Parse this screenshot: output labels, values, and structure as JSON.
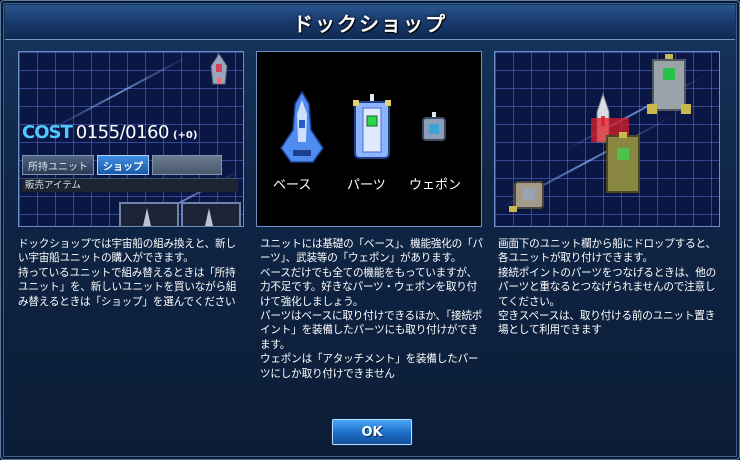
{
  "dialog": {
    "title": "ドックショップ",
    "ok_label": "OK"
  },
  "panel1": {
    "cost_label": "COST",
    "cost_value": "0155/0160",
    "cost_delta": "(+0)",
    "tab_owned": "所持ユニット",
    "tab_shop": "ショップ",
    "sale_items": "販売アイテム"
  },
  "panel2": {
    "base_label": "ベース",
    "parts_label": "パーツ",
    "weapon_label": "ウェポン"
  },
  "descriptions": {
    "left": "ドックショップでは宇宙船の組み換えと、新しい宇宙船ユニットの購入ができます。\n持っているユニットで組み替えるときは「所持ユニット」を、新しいユニットを買いながら組み替えるときは「ショップ」を選んでください",
    "middle": "ユニットには基礎の「ベース」、機能強化の「パーツ」、武装等の「ウェポン」があります。\nベースだけでも全ての機能をもっていますが、力不足です。好きなパーツ・ウェポンを取り付けて強化しましょう。\nパーツはベースに取り付けできるほか、「接続ポイント」を装備したパーツにも取り付けができます。\nウェポンは「アタッチメント」を装備したパーツにしか取り付けできません",
    "right": "画面下のユニット欄から船にドロップすると、各ユニットが取り付けできます。\n接続ポイントのパーツをつなげるときは、他のパーツと重なるとつなげられませんので注意してください。\n空きスペースは、取り付ける前のユニット置き場として利用できます"
  },
  "colors": {
    "accent_blue": "#53c8ff",
    "button_blue": "#1d6cc4",
    "grid": "#0a1644"
  }
}
